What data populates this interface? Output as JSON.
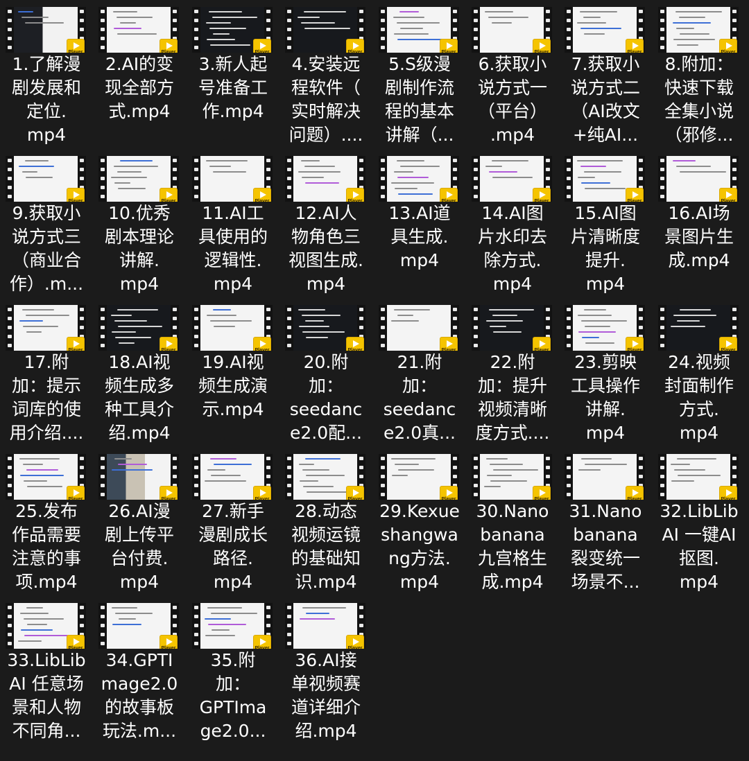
{
  "badge_label": "Player",
  "files": [
    {
      "lines": [
        "1.了解漫",
        "剧发展和",
        "定位.",
        "mp4"
      ]
    },
    {
      "lines": [
        "2.AI的变",
        "现全部方",
        "式.mp4"
      ]
    },
    {
      "lines": [
        "3.新人起",
        "号准备工",
        "作.mp4"
      ]
    },
    {
      "lines": [
        "4.安装远",
        "程软件（",
        "实时解决",
        "问题）...."
      ]
    },
    {
      "lines": [
        "5.S级漫",
        "剧制作流",
        "程的基本",
        "讲解（..."
      ]
    },
    {
      "lines": [
        "6.获取小",
        "说方式一",
        "（平台）",
        ".mp4"
      ]
    },
    {
      "lines": [
        "7.获取小",
        "说方式二",
        "（AI改文",
        "+纯AI..."
      ]
    },
    {
      "lines": [
        "8.附加：",
        "快速下载",
        "全集小说",
        "（邪修..."
      ]
    },
    {
      "lines": [
        "9.获取小",
        "说方式三",
        "（商业合",
        "作）.m..."
      ]
    },
    {
      "lines": [
        "10.优秀",
        "剧本理论",
        "讲解.",
        "mp4"
      ]
    },
    {
      "lines": [
        "11.AI工",
        "具使用的",
        "逻辑性.",
        "mp4"
      ]
    },
    {
      "lines": [
        "12.AI人",
        "物角色三",
        "视图生成.",
        "mp4"
      ]
    },
    {
      "lines": [
        "13.AI道",
        "具生成.",
        "mp4"
      ]
    },
    {
      "lines": [
        "14.AI图",
        "片水印去",
        "除方式.",
        "mp4"
      ]
    },
    {
      "lines": [
        "15.AI图",
        "片清晰度",
        "提升.",
        "mp4"
      ]
    },
    {
      "lines": [
        "16.AI场",
        "景图片生",
        "成.mp4"
      ]
    },
    {
      "lines": [
        "17.附",
        "加：提示",
        "词库的使",
        "用介绍...."
      ]
    },
    {
      "lines": [
        "18.AI视",
        "频生成多",
        "种工具介",
        "绍.mp4"
      ]
    },
    {
      "lines": [
        "19.AI视",
        "频生成演",
        "示.mp4"
      ]
    },
    {
      "lines": [
        "20.附",
        "加：",
        "seedanc",
        "e2.0配..."
      ]
    },
    {
      "lines": [
        "21.附",
        "加：",
        "seedanc",
        "e2.0真..."
      ]
    },
    {
      "lines": [
        "22.附",
        "加：提升",
        "视频清晰",
        "度方式...."
      ]
    },
    {
      "lines": [
        "23.剪映",
        "工具操作",
        "讲解.",
        "mp4"
      ]
    },
    {
      "lines": [
        "24.视频",
        "封面制作",
        "方式.",
        "mp4"
      ]
    },
    {
      "lines": [
        "25.发布",
        "作品需要",
        "注意的事",
        "项.mp4"
      ]
    },
    {
      "lines": [
        "26.AI漫",
        "剧上传平",
        "台付费.",
        "mp4"
      ]
    },
    {
      "lines": [
        "27.新手",
        "漫剧成长",
        "路径.",
        "mp4"
      ]
    },
    {
      "lines": [
        "28.动态",
        "视频运镜",
        "的基础知",
        "识.mp4"
      ]
    },
    {
      "lines": [
        "29.Kexue",
        "shangwa",
        "ng方法.",
        "mp4"
      ]
    },
    {
      "lines": [
        "30.Nano",
        "banana",
        "九宫格生",
        "成.mp4"
      ]
    },
    {
      "lines": [
        "31.Nano",
        "banana",
        "裂变统一",
        "场景不..."
      ]
    },
    {
      "lines": [
        "32.LibLib",
        "AI 一键AI",
        "抠图.",
        "mp4"
      ]
    },
    {
      "lines": [
        "33.LibLib",
        "AI 任意场",
        "景和人物",
        "不同角..."
      ]
    },
    {
      "lines": [
        "34.GPTI",
        "mage2.0",
        "的故事板",
        "玩法.m..."
      ]
    },
    {
      "lines": [
        "35.附",
        "加：",
        "GPTIma",
        "ge2.0..."
      ]
    },
    {
      "lines": [
        "36.AI接",
        "单视频赛",
        "道详细介",
        "绍.mp4"
      ]
    }
  ]
}
